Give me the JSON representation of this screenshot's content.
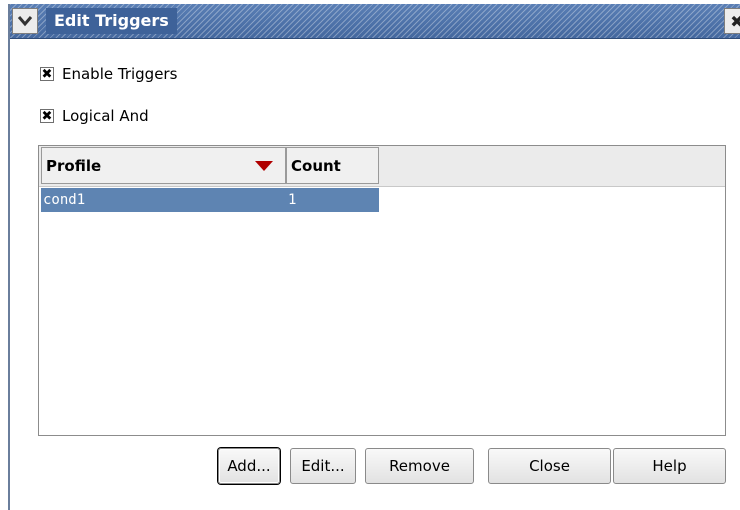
{
  "window": {
    "title": "Edit Triggers"
  },
  "options": {
    "enable_triggers": {
      "label": "Enable Triggers",
      "checked": true
    },
    "logical_and": {
      "label": "Logical And",
      "checked": true
    }
  },
  "table": {
    "columns": [
      {
        "label": "Profile",
        "sort": "descending"
      },
      {
        "label": "Count"
      }
    ],
    "rows": [
      {
        "profile": "cond1",
        "count": "1",
        "selected": true
      }
    ]
  },
  "buttons": {
    "add": "Add...",
    "edit": "Edit...",
    "remove": "Remove",
    "close": "Close",
    "help": "Help"
  },
  "colors": {
    "title_bar": "#4a70a8",
    "selection": "#5e84b2",
    "sort_arrow": "#b00000"
  },
  "icons": {
    "window_menu": "chevron-down-icon",
    "window_close": "close-icon",
    "sort_indicator": "sort-descending-icon",
    "check": "check-x-icon"
  }
}
